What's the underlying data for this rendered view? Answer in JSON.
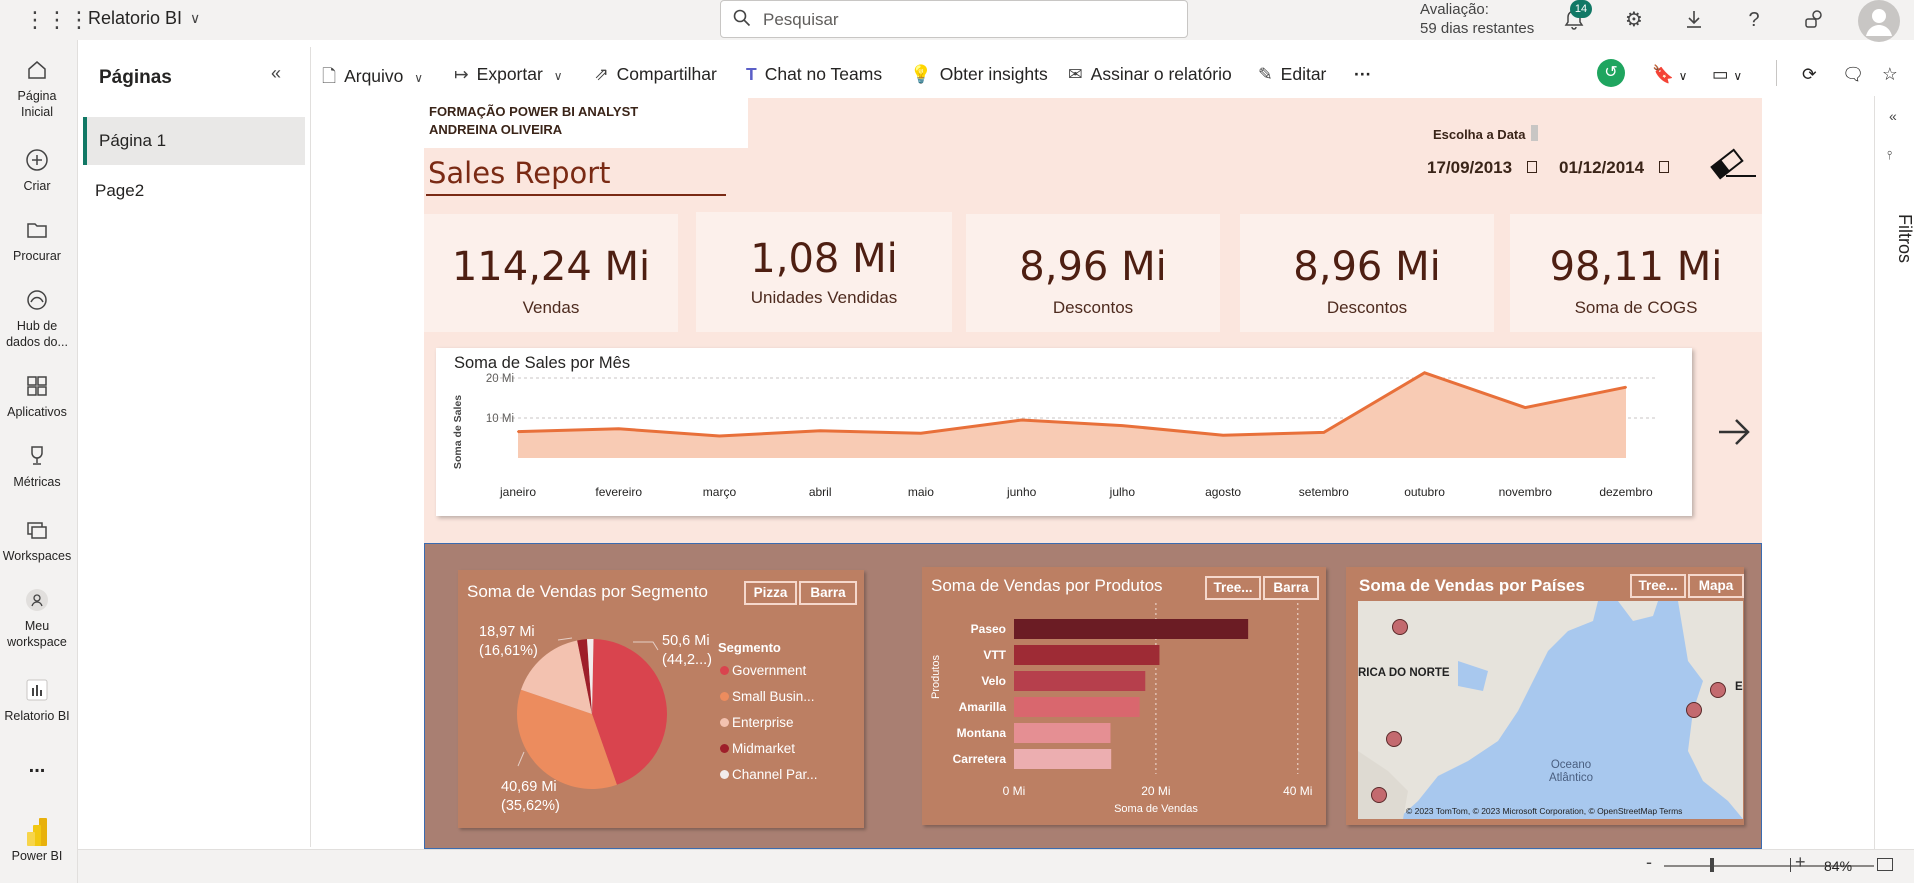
{
  "app": {
    "workspace_name": "Relatorio BI",
    "search_placeholder": "Pesquisar",
    "trial_label": "Avaliação:",
    "trial_days": "59 dias restantes",
    "notification_count": "14"
  },
  "leftnav": [
    {
      "label": "Página Inicial",
      "icon": "home-icon"
    },
    {
      "label": "Criar",
      "icon": "plus-circle-icon"
    },
    {
      "label": "Procurar",
      "icon": "folder-icon"
    },
    {
      "label": "Hub de dados do...",
      "icon": "data-hub-icon"
    },
    {
      "label": "Aplicativos",
      "icon": "apps-icon"
    },
    {
      "label": "Métricas",
      "icon": "trophy-icon"
    },
    {
      "label": "Workspaces",
      "icon": "workspaces-icon"
    },
    {
      "label": "Meu workspace",
      "icon": "person-icon"
    },
    {
      "label": "Relatorio BI",
      "icon": "report-icon"
    },
    {
      "label": "...",
      "icon": "more-icon"
    },
    {
      "label": "Power BI",
      "icon": "powerbi-logo-icon"
    }
  ],
  "pages_panel": {
    "title": "Páginas",
    "pages": [
      "Página 1",
      "Page2"
    ]
  },
  "toolbar": {
    "file": "Arquivo",
    "export": "Exportar",
    "share": "Compartilhar",
    "teams": "Chat no Teams",
    "insights": "Obter insights",
    "subscribe": "Assinar o relatório",
    "edit": "Editar",
    "more": "···"
  },
  "report": {
    "header_line1": "FORMAÇÃO POWER BI ANALYST",
    "header_line2": "ANDREINA OLIVEIRA",
    "title": "Sales Report",
    "date_label": "Escolha a Data",
    "date_from": "17/09/2013",
    "date_to": "01/12/2014",
    "kpis": [
      {
        "value": "114,24 Mi",
        "label": "Vendas"
      },
      {
        "value": "1,08 Mi",
        "label": "Unidades Vendidas"
      },
      {
        "value": "8,96 Mi",
        "label": "Descontos"
      },
      {
        "value": "8,96 Mi",
        "label": "Descontos"
      },
      {
        "value": "98,11 Mi",
        "label": "Soma de COGS"
      }
    ],
    "filters_label": "Filtros",
    "zoom": "84%"
  },
  "chart_data": [
    {
      "type": "area",
      "title": "Soma de Sales por Mês",
      "ylabel": "Soma de Sales",
      "xlabel": "",
      "yticks": [
        "10 Mi",
        "20 Mi"
      ],
      "ylim": [
        0,
        25
      ],
      "categories": [
        "janeiro",
        "fevereiro",
        "março",
        "abril",
        "maio",
        "junho",
        "julho",
        "agosto",
        "setembro",
        "outubro",
        "novembro",
        "dezembro"
      ],
      "values": [
        6.6,
        7.3,
        5.5,
        6.8,
        6.2,
        9.5,
        8.1,
        5.7,
        6.4,
        21.3,
        12.6,
        17.7
      ],
      "color": "#e8703a"
    },
    {
      "type": "pie",
      "title": "Soma de Vendas por Segmento",
      "legend_title": "Segmento",
      "buttons": [
        "Pizza",
        "Barra"
      ],
      "labels": [
        "Government",
        "Small Busin...",
        "Enterprise",
        "Midmarket",
        "Channel Par..."
      ],
      "values": [
        50.6,
        40.69,
        18.97,
        2.4,
        1.58
      ],
      "colors": [
        "#d9444e",
        "#ec8c5e",
        "#f3c2b0",
        "#9e1f2a",
        "#f2ecec"
      ],
      "data_labels": [
        {
          "value": "50,6 Mi",
          "pct": "(44,2...)"
        },
        {
          "value": "40,69 Mi",
          "pct": "(35,62%)"
        },
        {
          "value": "18,97 Mi",
          "pct": "(16,61%)"
        }
      ]
    },
    {
      "type": "bar",
      "title": "Soma de Vendas por Produtos",
      "buttons": [
        "Tree...",
        "Barra"
      ],
      "ylabel": "Produtos",
      "xlabel": "Soma de Vendas",
      "xticks": [
        "0 Mi",
        "20 Mi",
        "40 Mi"
      ],
      "xlim": [
        0,
        42
      ],
      "categories": [
        "Paseo",
        "VTT",
        "Velo",
        "Amarilla",
        "Montana",
        "Carretera"
      ],
      "values": [
        33.0,
        20.5,
        18.5,
        17.7,
        13.6,
        13.7
      ],
      "colors": [
        "#6b1c24",
        "#9e2b35",
        "#b63f4c",
        "#d9676e",
        "#e58f93",
        "#ecaeb0"
      ]
    },
    {
      "type": "map",
      "title": "Soma de Vendas por Países",
      "buttons": [
        "Tree...",
        "Mapa"
      ],
      "map_labels": [
        "RICA DO NORTE",
        "Oceano Atlântico",
        "E"
      ],
      "attribution": "© 2023 TomTom, © 2023 Microsoft Corporation, © OpenStreetMap  Terms",
      "points": [
        "Canada",
        "United States of America",
        "Mexico",
        "France",
        "Germany"
      ]
    }
  ],
  "colors": {
    "accent": "#117865",
    "report_bg": "#fbe6de",
    "kpi_text": "#4e1f12",
    "bottom_bg": "#a97f72",
    "card_bg": "#bc7f63"
  }
}
